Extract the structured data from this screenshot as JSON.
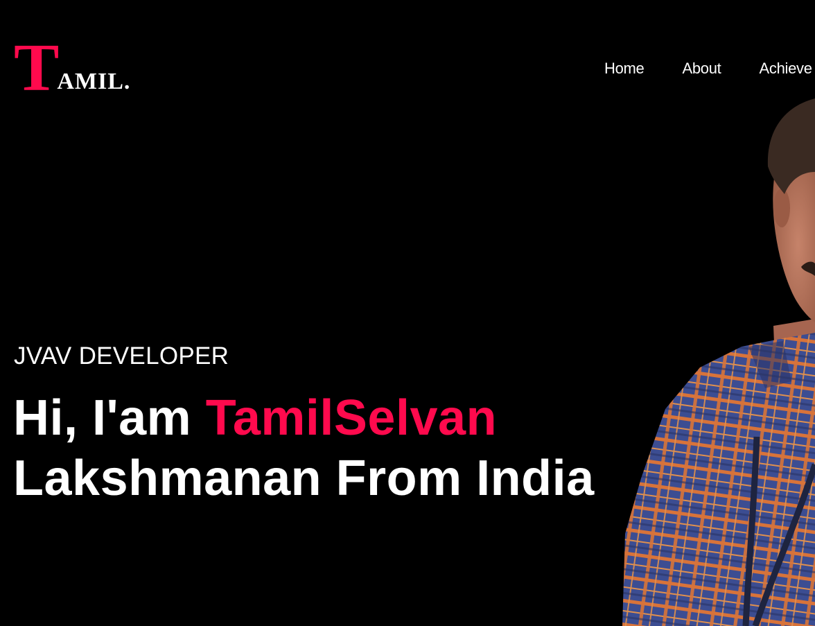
{
  "logo": {
    "initial": "T",
    "rest": "AMIL.",
    "initial_color": "#ff0a4d"
  },
  "nav": {
    "items": [
      "Home",
      "About",
      "Achieve"
    ]
  },
  "hero": {
    "subtitle": "JVAV DEVELOPER",
    "greeting": "Hi, I'am ",
    "name_highlight": "TamilSelvan",
    "line2": "Lakshmanan From India",
    "accent_color": "#ff0a4d"
  },
  "colors": {
    "background": "#000000",
    "text": "#ffffff",
    "accent": "#ff0a4d"
  }
}
